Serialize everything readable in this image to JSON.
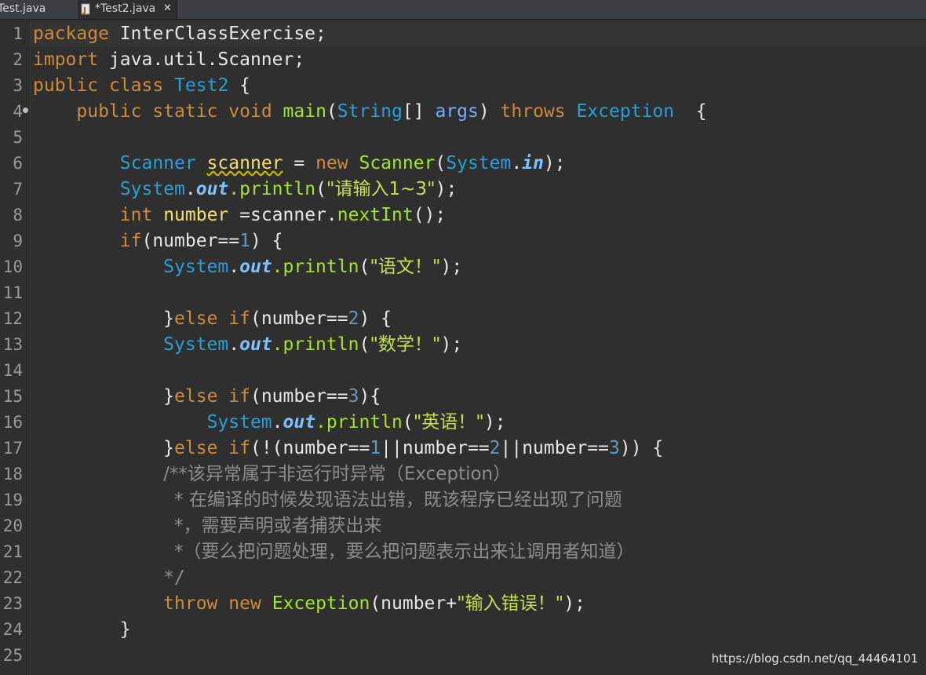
{
  "tabs": [
    {
      "label": "Test.java",
      "active": false
    },
    {
      "label": "*Test2.java",
      "active": true,
      "close": "✕"
    }
  ],
  "line_numbers": [
    "1",
    "2",
    "3",
    "4",
    "5",
    "6",
    "7",
    "8",
    "9",
    "10",
    "11",
    "12",
    "13",
    "14",
    "15",
    "16",
    "17",
    "18",
    "19",
    "20",
    "21",
    "22",
    "23",
    "24",
    "25"
  ],
  "code": {
    "l1": {
      "kw": "package",
      "rest": " InterClassExercise;"
    },
    "l2": {
      "kw": "import",
      "rest": " java.util.Scanner;"
    },
    "l3": {
      "kw1": "public",
      "kw2": "class",
      "ty": "Test2",
      "rest": " {"
    },
    "l4": {
      "indent": "    ",
      "kw1": "public",
      "kw2": "static",
      "kw3": "void",
      "fn": "main",
      "p1": "(",
      "ty": "String",
      "p2": "[] ",
      "param": "args",
      "p3": ") ",
      "kw4": "throws",
      "ty2": "Exception",
      "p4": "  {"
    },
    "l6": {
      "indent": "        ",
      "ty": "Scanner",
      "var": "scanner",
      "p1": " = ",
      "kw": "new",
      "fn": "Scanner",
      "p2": "(",
      "ty2": "System",
      "dot": ".",
      "fld": "in",
      "p3": ");"
    },
    "l7": {
      "indent": "        ",
      "ty": "System",
      "dot": ".",
      "fld": "out",
      "fn": ".println",
      "p1": "(",
      "str": "\"请输入1~3\"",
      "p2": ");"
    },
    "l8": {
      "indent": "        ",
      "kw": "int",
      "var": "number",
      "rest": " =scanner.",
      "fn": "nextInt",
      "p1": "();"
    },
    "l9": {
      "indent": "        ",
      "kw": "if",
      "p1": "(number==",
      "num": "1",
      "p2": ") {"
    },
    "l10": {
      "indent": "            ",
      "ty": "System",
      "dot": ".",
      "fld": "out",
      "fn": ".println",
      "p1": "(",
      "str": "\"语文！\"",
      "p2": ");"
    },
    "l12": {
      "indent": "            ",
      "p0": "}",
      "kw1": "else",
      "kw2": "if",
      "p1": "(number==",
      "num": "2",
      "p2": ") {"
    },
    "l13": {
      "indent": "            ",
      "ty": "System",
      "dot": ".",
      "fld": "out",
      "fn": ".println",
      "p1": "(",
      "str": "\"数学！\"",
      "p2": ");"
    },
    "l15": {
      "indent": "            ",
      "p0": "}",
      "kw1": "else",
      "kw2": "if",
      "p1": "(number==",
      "num": "3",
      "p2": "){"
    },
    "l16": {
      "indent": "                ",
      "ty": "System",
      "dot": ".",
      "fld": "out",
      "fn": ".println",
      "p1": "(",
      "str": "\"英语！\"",
      "p2": ");"
    },
    "l17": {
      "indent": "            ",
      "p0": "}",
      "kw1": "else",
      "kw2": "if",
      "p1": "(!(number==",
      "n1": "1",
      "p2": "||number==",
      "n2": "2",
      "p3": "||number==",
      "n3": "3",
      "p4": ")) {"
    },
    "l18": {
      "indent": "            ",
      "cmt": "/**该异常属于非运行时异常（Exception）"
    },
    "l19": {
      "indent": "             ",
      "cmt": "* 在编译的时候发现语法出错，既该程序已经出现了问题"
    },
    "l20": {
      "indent": "             ",
      "cmt": "*，需要声明或者捕获出来"
    },
    "l21": {
      "indent": "             ",
      "cmt": "*（要么把问题处理，要么把问题表示出来让调用者知道）"
    },
    "l22": {
      "indent": "            ",
      "cmt": "*/"
    },
    "l23": {
      "indent": "            ",
      "kw1": "throw",
      "kw2": "new",
      "fn": "Exception",
      "p1": "(number+",
      "str": "\"输入错误！\"",
      "p2": ");"
    },
    "l24": {
      "indent": "        ",
      "p": "}"
    }
  },
  "watermark": "https://blog.csdn.net/qq_44464101",
  "colors": {
    "keyword": "#cc8c3c",
    "type": "#2a9fd6",
    "function": "#a6e22e",
    "string": "#c0e050",
    "number": "#6897bb",
    "comment": "#8c8c8c",
    "background": "#2f2f2f"
  }
}
